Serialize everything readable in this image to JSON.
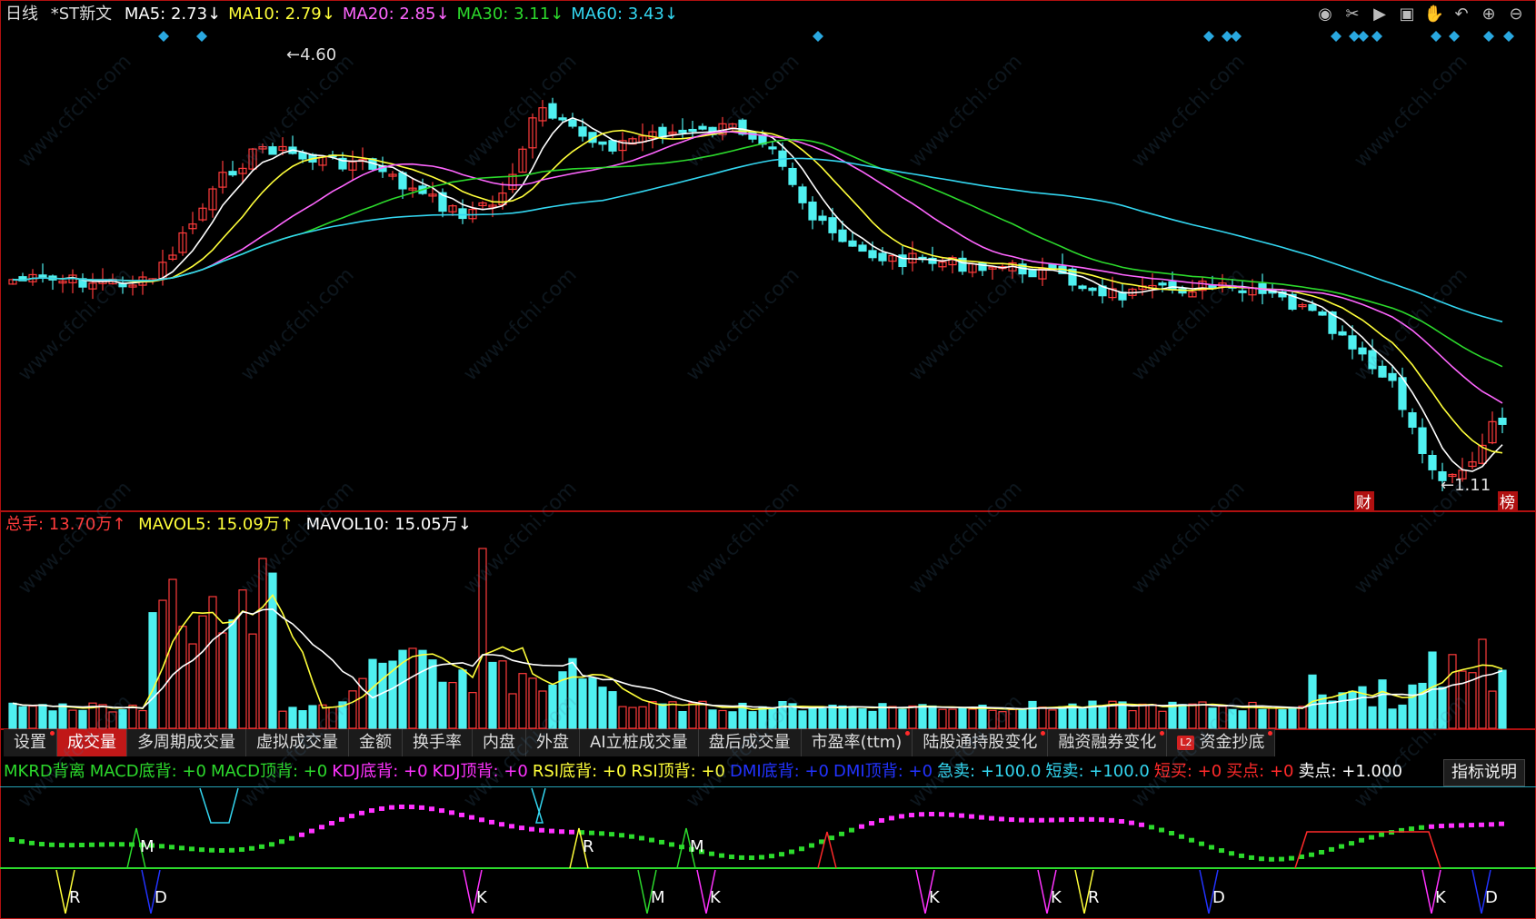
{
  "header": {
    "period": "日线",
    "stock": "*ST新文",
    "ma": [
      {
        "label": "MA5: 2.73↓",
        "color": "#ffffff"
      },
      {
        "label": "MA10: 2.79↓",
        "color": "#ffff3a"
      },
      {
        "label": "MA20: 2.85↓",
        "color": "#ff66ff"
      },
      {
        "label": "MA30: 3.11↓",
        "color": "#2cd92c"
      },
      {
        "label": "MA60: 3.43↓",
        "color": "#33d6f0"
      }
    ]
  },
  "toolbar_icons": [
    "eye-icon",
    "scissors-icon",
    "play-icon",
    "lock-icon",
    "hand-icon",
    "undo-icon",
    "zoom-in-icon",
    "zoom-out-icon"
  ],
  "price_chart": {
    "high_label": "4.60",
    "low_label": "1.11",
    "badges": [
      "财",
      "榜"
    ]
  },
  "volume_header": {
    "total": "总手: 13.70万↑",
    "mavol5": "MAVOL5: 15.09万↑",
    "mavol10": "MAVOL10: 15.05万↓"
  },
  "tabs": [
    {
      "label": "设置",
      "dot": true
    },
    {
      "label": "成交量",
      "active": true
    },
    {
      "label": "多周期成交量"
    },
    {
      "label": "虚拟成交量"
    },
    {
      "label": "金额"
    },
    {
      "label": "换手率"
    },
    {
      "label": "内盘"
    },
    {
      "label": "外盘"
    },
    {
      "label": "AI立桩成交量"
    },
    {
      "label": "盘后成交量"
    },
    {
      "label": "市盈率(ttm)",
      "dot": true
    },
    {
      "label": "陆股通持股变化",
      "dot": true
    },
    {
      "label": "融资融券变化",
      "dot": true
    },
    {
      "label": "资金抄底",
      "l2": "L2",
      "dot": true
    }
  ],
  "indicator_legend": [
    {
      "text": "MKRD背离",
      "color": "#2cd92c"
    },
    {
      "text": "MACD底背: +0",
      "color": "#2cd92c"
    },
    {
      "text": "MACD顶背: +0",
      "color": "#2cd92c"
    },
    {
      "text": "KDJ底背: +0",
      "color": "#ff33ff"
    },
    {
      "text": "KDJ顶背: +0",
      "color": "#ff33ff"
    },
    {
      "text": "RSI底背: +0",
      "color": "#ffff3a"
    },
    {
      "text": "RSI顶背: +0",
      "color": "#ffff3a"
    },
    {
      "text": "DMI底背: +0",
      "color": "#2233ff"
    },
    {
      "text": "DMI顶背: +0",
      "color": "#2233ff"
    },
    {
      "text": "急卖: +100.0",
      "color": "#33d6f0"
    },
    {
      "text": "短卖: +100.0",
      "color": "#33d6f0"
    },
    {
      "text": "短买: +0",
      "color": "#ff2a2a"
    },
    {
      "text": "买点: +0",
      "color": "#ff2a2a"
    },
    {
      "text": "卖点: +1.000",
      "color": "#ffffff"
    }
  ],
  "explain_button": "指标说明",
  "signal_labels": {
    "r": "R",
    "m": "M",
    "d": "D",
    "k": "K"
  },
  "watermark": "www.cfchi.com",
  "colors": {
    "up": "#ff3b3b",
    "down": "#4ff0f0",
    "ma5": "#ffffff",
    "ma10": "#ffff3a",
    "ma20": "#ff66ff",
    "ma30": "#2cd92c",
    "ma60": "#33d6f0",
    "frame": "#b01010"
  }
}
